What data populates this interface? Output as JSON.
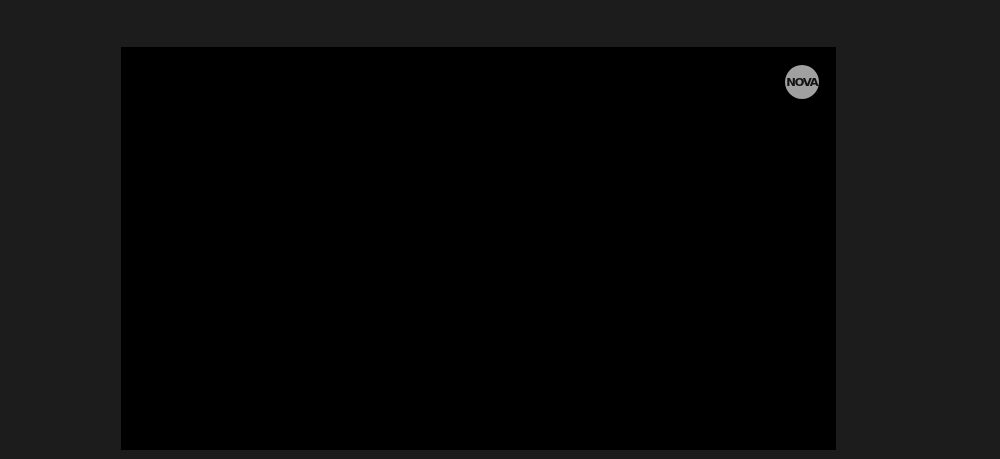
{
  "colors": {
    "page_background": "#1c1c1c",
    "player_background": "#000000",
    "logo_background": "#a0a0a0",
    "logo_text": "#111111"
  },
  "player": {
    "logo": {
      "icon": "nova-logo-icon",
      "text": "NOVA"
    }
  }
}
